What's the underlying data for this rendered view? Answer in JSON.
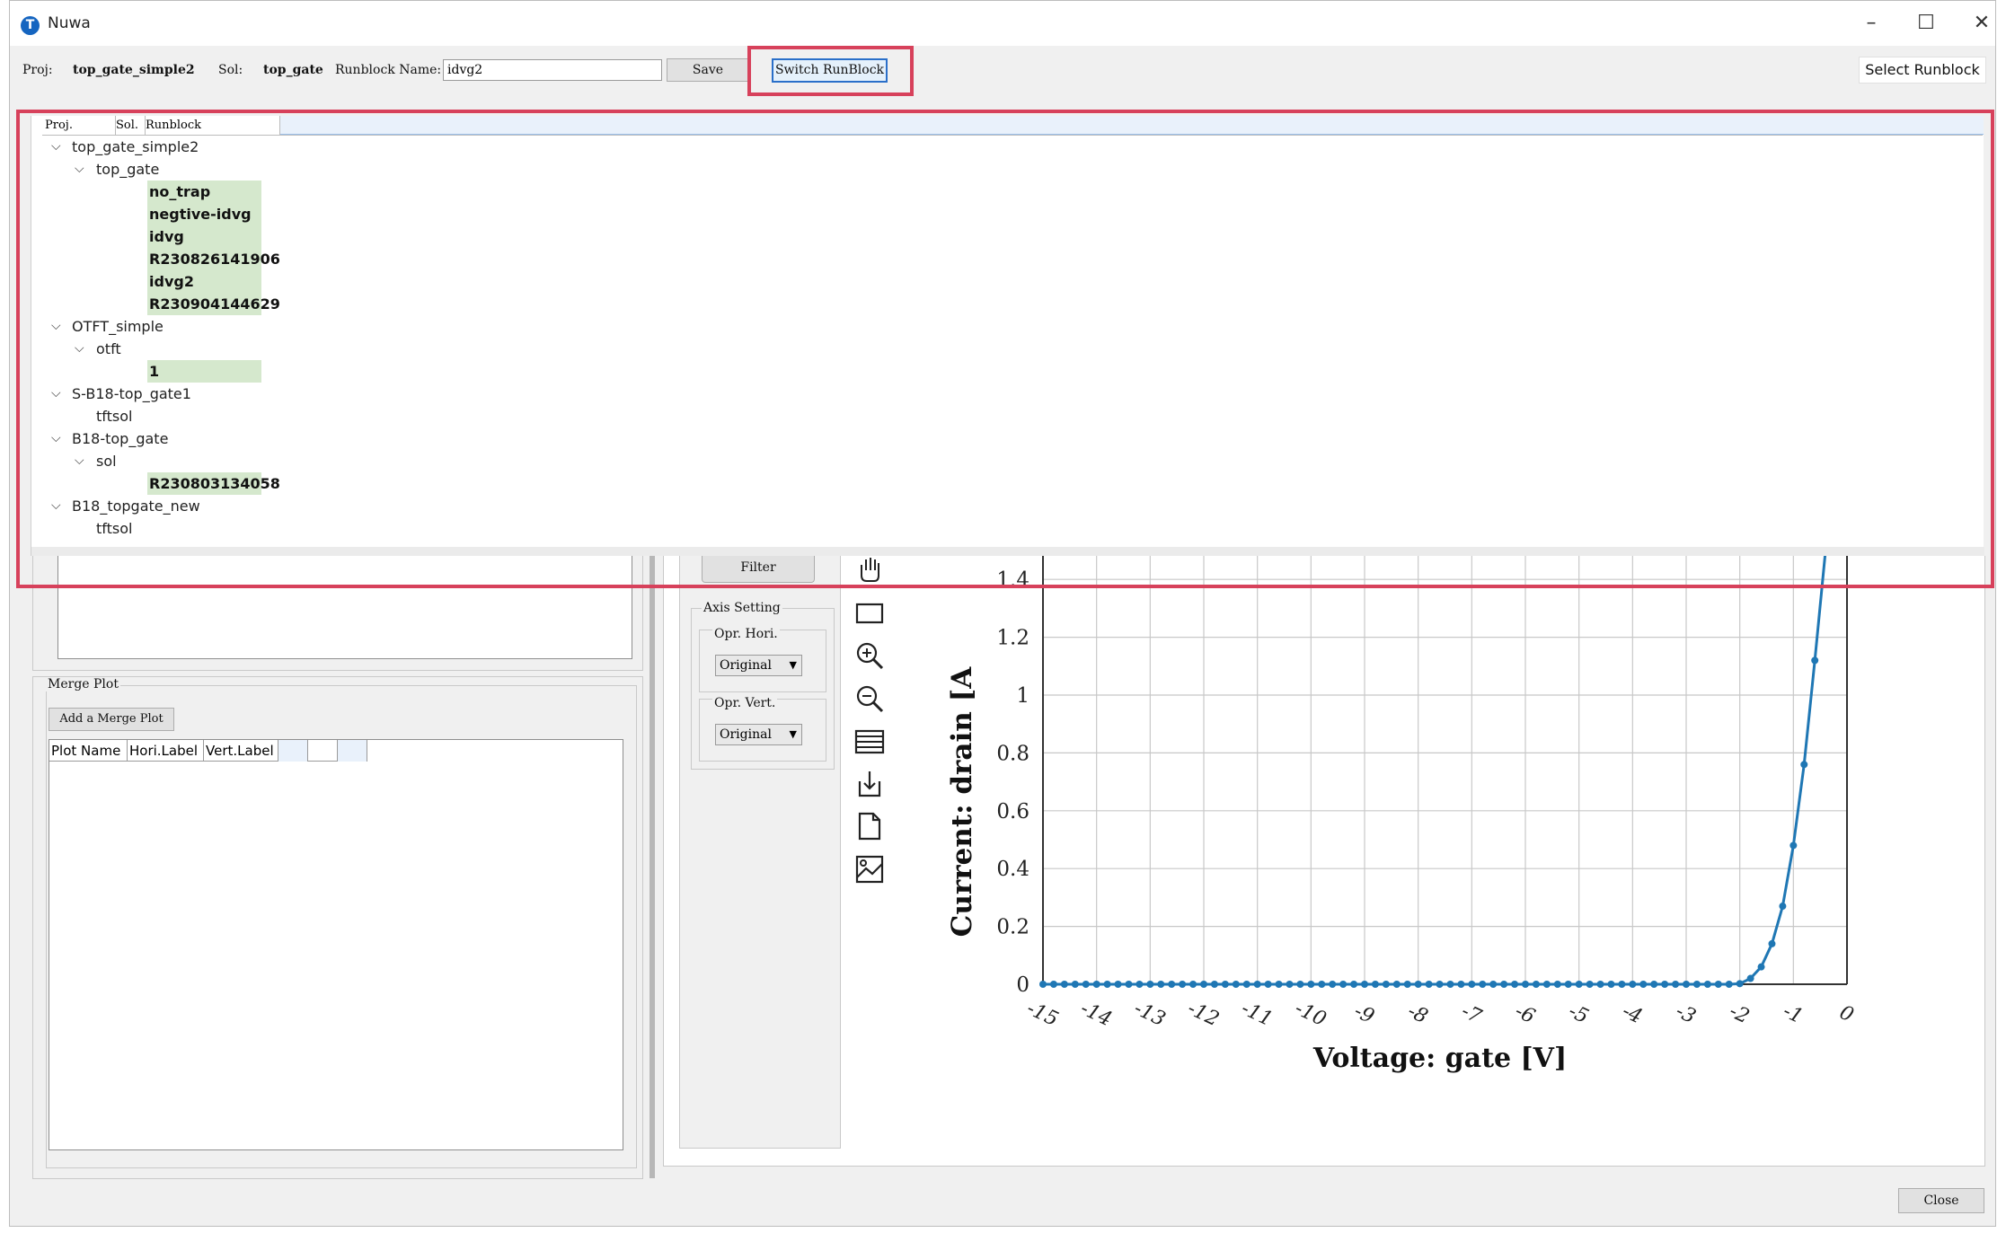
{
  "window": {
    "title": "Nuwa",
    "icon_letter": "T",
    "controls": [
      "minimize-icon",
      "maximize-icon",
      "close-icon"
    ]
  },
  "toolbar": {
    "proj_label": "Proj:",
    "proj_value": "top_gate_simple2",
    "sol_label": "Sol:",
    "sol_value": "top_gate",
    "runblock_label": "Runblock Name:",
    "runblock_value": "idvg2",
    "save_label": "Save",
    "switch_label": "Switch RunBlock",
    "select_label": "Select Runblock"
  },
  "tree": {
    "columns": [
      "Proj.",
      "Sol.",
      "Runblock"
    ],
    "nodes": [
      {
        "label": "top_gate_simple2"
      },
      {
        "label": "top_gate"
      },
      {
        "label": "no_trap"
      },
      {
        "label": "negtive-idvg"
      },
      {
        "label": "idvg"
      },
      {
        "label": "R230826141906"
      },
      {
        "label": "idvg2"
      },
      {
        "label": "R230904144629"
      },
      {
        "label": "OTFT_simple"
      },
      {
        "label": "otft"
      },
      {
        "label": "1"
      },
      {
        "label": "S-B18-top_gate1"
      },
      {
        "label": "tftsol"
      },
      {
        "label": "B18-top_gate"
      },
      {
        "label": "sol"
      },
      {
        "label": "R230803134058"
      },
      {
        "label": "B18_topgate_new"
      },
      {
        "label": "tftsol"
      }
    ]
  },
  "merge_plot": {
    "group_title": "Merge Plot",
    "add_label": "Add a Merge Plot",
    "columns": [
      "Plot Name",
      "Hori.Label",
      "Vert.Label",
      "",
      "",
      ""
    ]
  },
  "controls": {
    "filter_label": "Filter",
    "axis_setting_label": "Axis Setting",
    "hori_label": "Opr. Hori.",
    "hori_value": "Original",
    "vert_label": "Opr. Vert.",
    "vert_value": "Original"
  },
  "graph_tools": [
    "pan-icon",
    "rectangle-select-icon",
    "zoom-in-icon",
    "zoom-out-icon",
    "table-icon",
    "download-icon",
    "document-icon",
    "image-export-icon"
  ],
  "footer": {
    "close_label": "Close"
  },
  "chart_data": {
    "type": "line",
    "xlabel": "Voltage: gate [V]",
    "ylabel": "Current: drain [A",
    "xlim": [
      -15,
      0
    ],
    "ylim": [
      0,
      1.5
    ],
    "x_ticks": [
      "-15",
      "-14",
      "-13",
      "-12",
      "-11",
      "-10",
      "-9",
      "-8",
      "-7",
      "-6",
      "-5",
      "-4",
      "-3",
      "-2",
      "-1",
      "0"
    ],
    "y_ticks": [
      "0",
      "0.2",
      "0.4",
      "0.6",
      "0.8",
      "1",
      "1.2",
      "1.4"
    ],
    "grid": true,
    "color": "#1f77b4",
    "x": [
      -15,
      -14.8,
      -14.6,
      -14.4,
      -14.2,
      -14,
      -13.8,
      -13.6,
      -13.4,
      -13.2,
      -13,
      -12.8,
      -12.6,
      -12.4,
      -12.2,
      -12,
      -11.8,
      -11.6,
      -11.4,
      -11.2,
      -11,
      -10.8,
      -10.6,
      -10.4,
      -10.2,
      -10,
      -9.8,
      -9.6,
      -9.4,
      -9.2,
      -9,
      -8.8,
      -8.6,
      -8.4,
      -8.2,
      -8,
      -7.8,
      -7.6,
      -7.4,
      -7.2,
      -7,
      -6.8,
      -6.6,
      -6.4,
      -6.2,
      -6,
      -5.8,
      -5.6,
      -5.4,
      -5.2,
      -5,
      -4.8,
      -4.6,
      -4.4,
      -4.2,
      -4,
      -3.8,
      -3.6,
      -3.4,
      -3.2,
      -3,
      -2.8,
      -2.6,
      -2.4,
      -2.2,
      -2,
      -1.8,
      -1.6,
      -1.4,
      -1.2,
      -1,
      -0.8,
      -0.6,
      -0.4
    ],
    "y": [
      0,
      0,
      0,
      0,
      0,
      0,
      0,
      0,
      0,
      0,
      0,
      0,
      0,
      0,
      0,
      0,
      0,
      0,
      0,
      0,
      0,
      0,
      0,
      0,
      0,
      0,
      0,
      0,
      0,
      0,
      0,
      0,
      0,
      0,
      0,
      0,
      0,
      0,
      0,
      0,
      0,
      0,
      0,
      0,
      0,
      0,
      0,
      0,
      0,
      0,
      0,
      0,
      0,
      0,
      0,
      0,
      0,
      0,
      0,
      0,
      0,
      0,
      0,
      0,
      0,
      0.002,
      0.02,
      0.06,
      0.14,
      0.27,
      0.48,
      0.76,
      1.12,
      1.5
    ]
  }
}
